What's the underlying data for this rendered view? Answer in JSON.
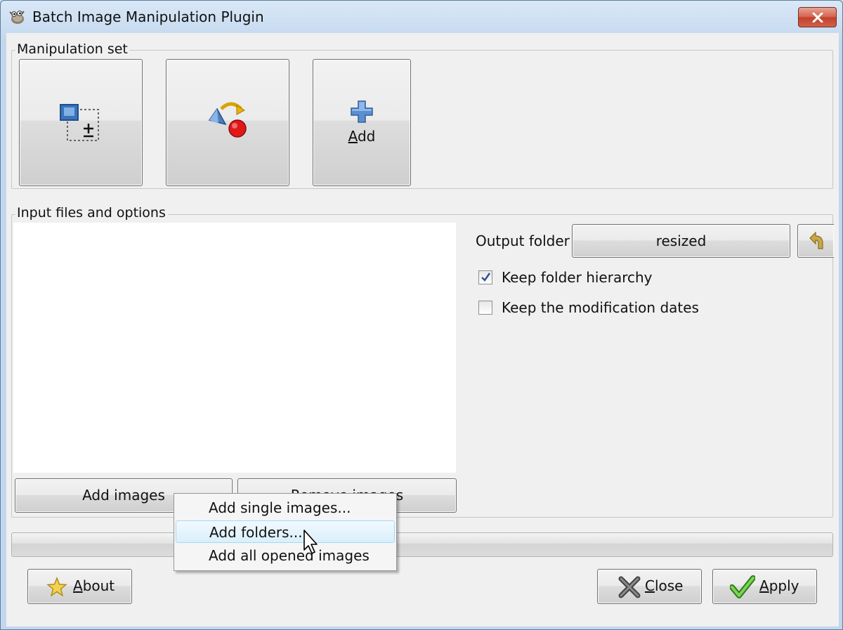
{
  "window": {
    "title": "Batch Image Manipulation Plugin",
    "app_icon": "gimp-wilber-icon",
    "close_icon": "close-icon"
  },
  "manipulation_set": {
    "label": "Manipulation set",
    "buttons": [
      {
        "name": "resize",
        "icon": "resize-icon"
      },
      {
        "name": "rotate-flip",
        "icon": "rotate-flip-icon"
      },
      {
        "name": "add",
        "icon": "plus-icon",
        "label_mnemonic": "A",
        "label_rest": "dd"
      }
    ]
  },
  "input_files": {
    "label": "Input files and options",
    "add_images_label": "Add images",
    "remove_images_label": "Remove images",
    "output_folder_label": "Output folder",
    "output_folder_value": "resized",
    "keep_hierarchy_label": "Keep folder hierarchy",
    "keep_hierarchy_checked": true,
    "keep_dates_label": "Keep the modification dates",
    "keep_dates_checked": false
  },
  "context_menu": {
    "items": [
      {
        "label": "Add single images..."
      },
      {
        "label": "Add folders...",
        "highlighted": true
      },
      {
        "label": "Add all opened images"
      }
    ]
  },
  "footer": {
    "about_mnemonic": "A",
    "about_rest": "bout",
    "close_mnemonic": "C",
    "close_rest": "lose",
    "apply_mnemonic": "A",
    "apply_rest": "pply"
  },
  "colors": {
    "accent_blue": "#3b73b9",
    "highlight_border": "#a8d8f4",
    "check_green": "#4caa2a"
  }
}
